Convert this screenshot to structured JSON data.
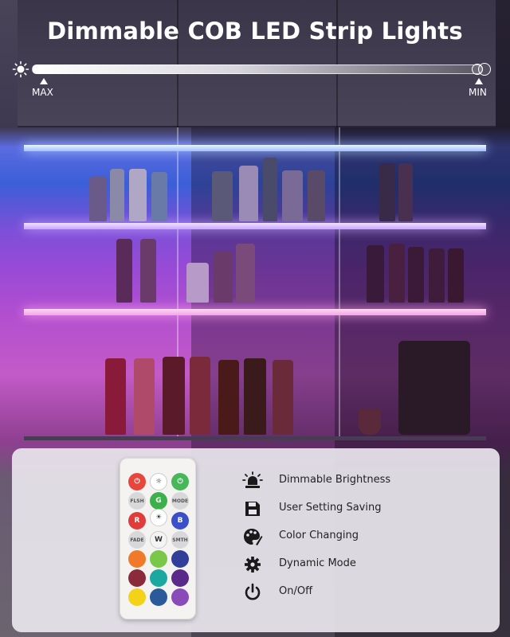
{
  "header": {
    "title": "Dimmable COB LED Strip Lights"
  },
  "brightness_slider": {
    "max_label": "MAX",
    "min_label": "MIN",
    "icon": "sun-icon"
  },
  "remote": {
    "icon": "remote-control",
    "letters": [
      "G",
      "R",
      "B",
      "W"
    ],
    "colors": {
      "power_red": "#e8453c",
      "power_green": "#46b85a",
      "red": "#e03c3c",
      "green": "#3cb04a",
      "blue": "#3b4fc8",
      "white": "#f4f4f4",
      "gray": "#9a9aa0",
      "orange": "#f07a2a",
      "light_green": "#7ac84a",
      "dark_blue": "#2f3f9a",
      "maroon": "#8a2a3a",
      "teal": "#1aa8a0",
      "purple": "#5a2a8a",
      "yellow": "#f4d21a",
      "steel_blue": "#2a5a9a",
      "violet": "#8a4ab8"
    }
  },
  "features": [
    {
      "icon": "alarm-light-icon",
      "label": "Dimmable Brightness"
    },
    {
      "icon": "floppy-disk-icon",
      "label": "User Setting Saving"
    },
    {
      "icon": "palette-icon",
      "label": "Color Changing"
    },
    {
      "icon": "gear-icon",
      "label": "Dynamic Mode"
    },
    {
      "icon": "power-icon",
      "label": "On/Off"
    }
  ]
}
